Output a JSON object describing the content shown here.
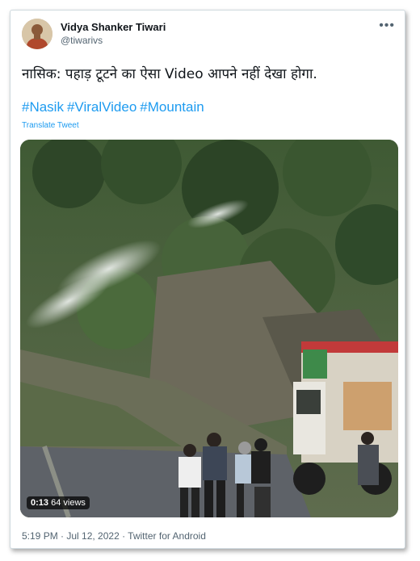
{
  "author": {
    "name": "Vidya Shanker Tiwari",
    "handle": "@tiwarivs"
  },
  "more_icon": "more-horizontal-icon",
  "tweet_text": "नासिक: पहाड़ टूटने का ऐसा Video आपने नहीं देखा होगा.",
  "hashtags": [
    "#Nasik",
    "#ViralVideo",
    "#Mountain"
  ],
  "translate_label": "Translate Tweet",
  "media": {
    "duration": "0:13",
    "views": "64 views"
  },
  "meta": {
    "timestamp": "5:19 PM · Jul 12, 2022 · Twitter for Android"
  },
  "colors": {
    "link": "#1d9bf0",
    "secondary_text": "#536471",
    "border": "#cfd9de"
  }
}
